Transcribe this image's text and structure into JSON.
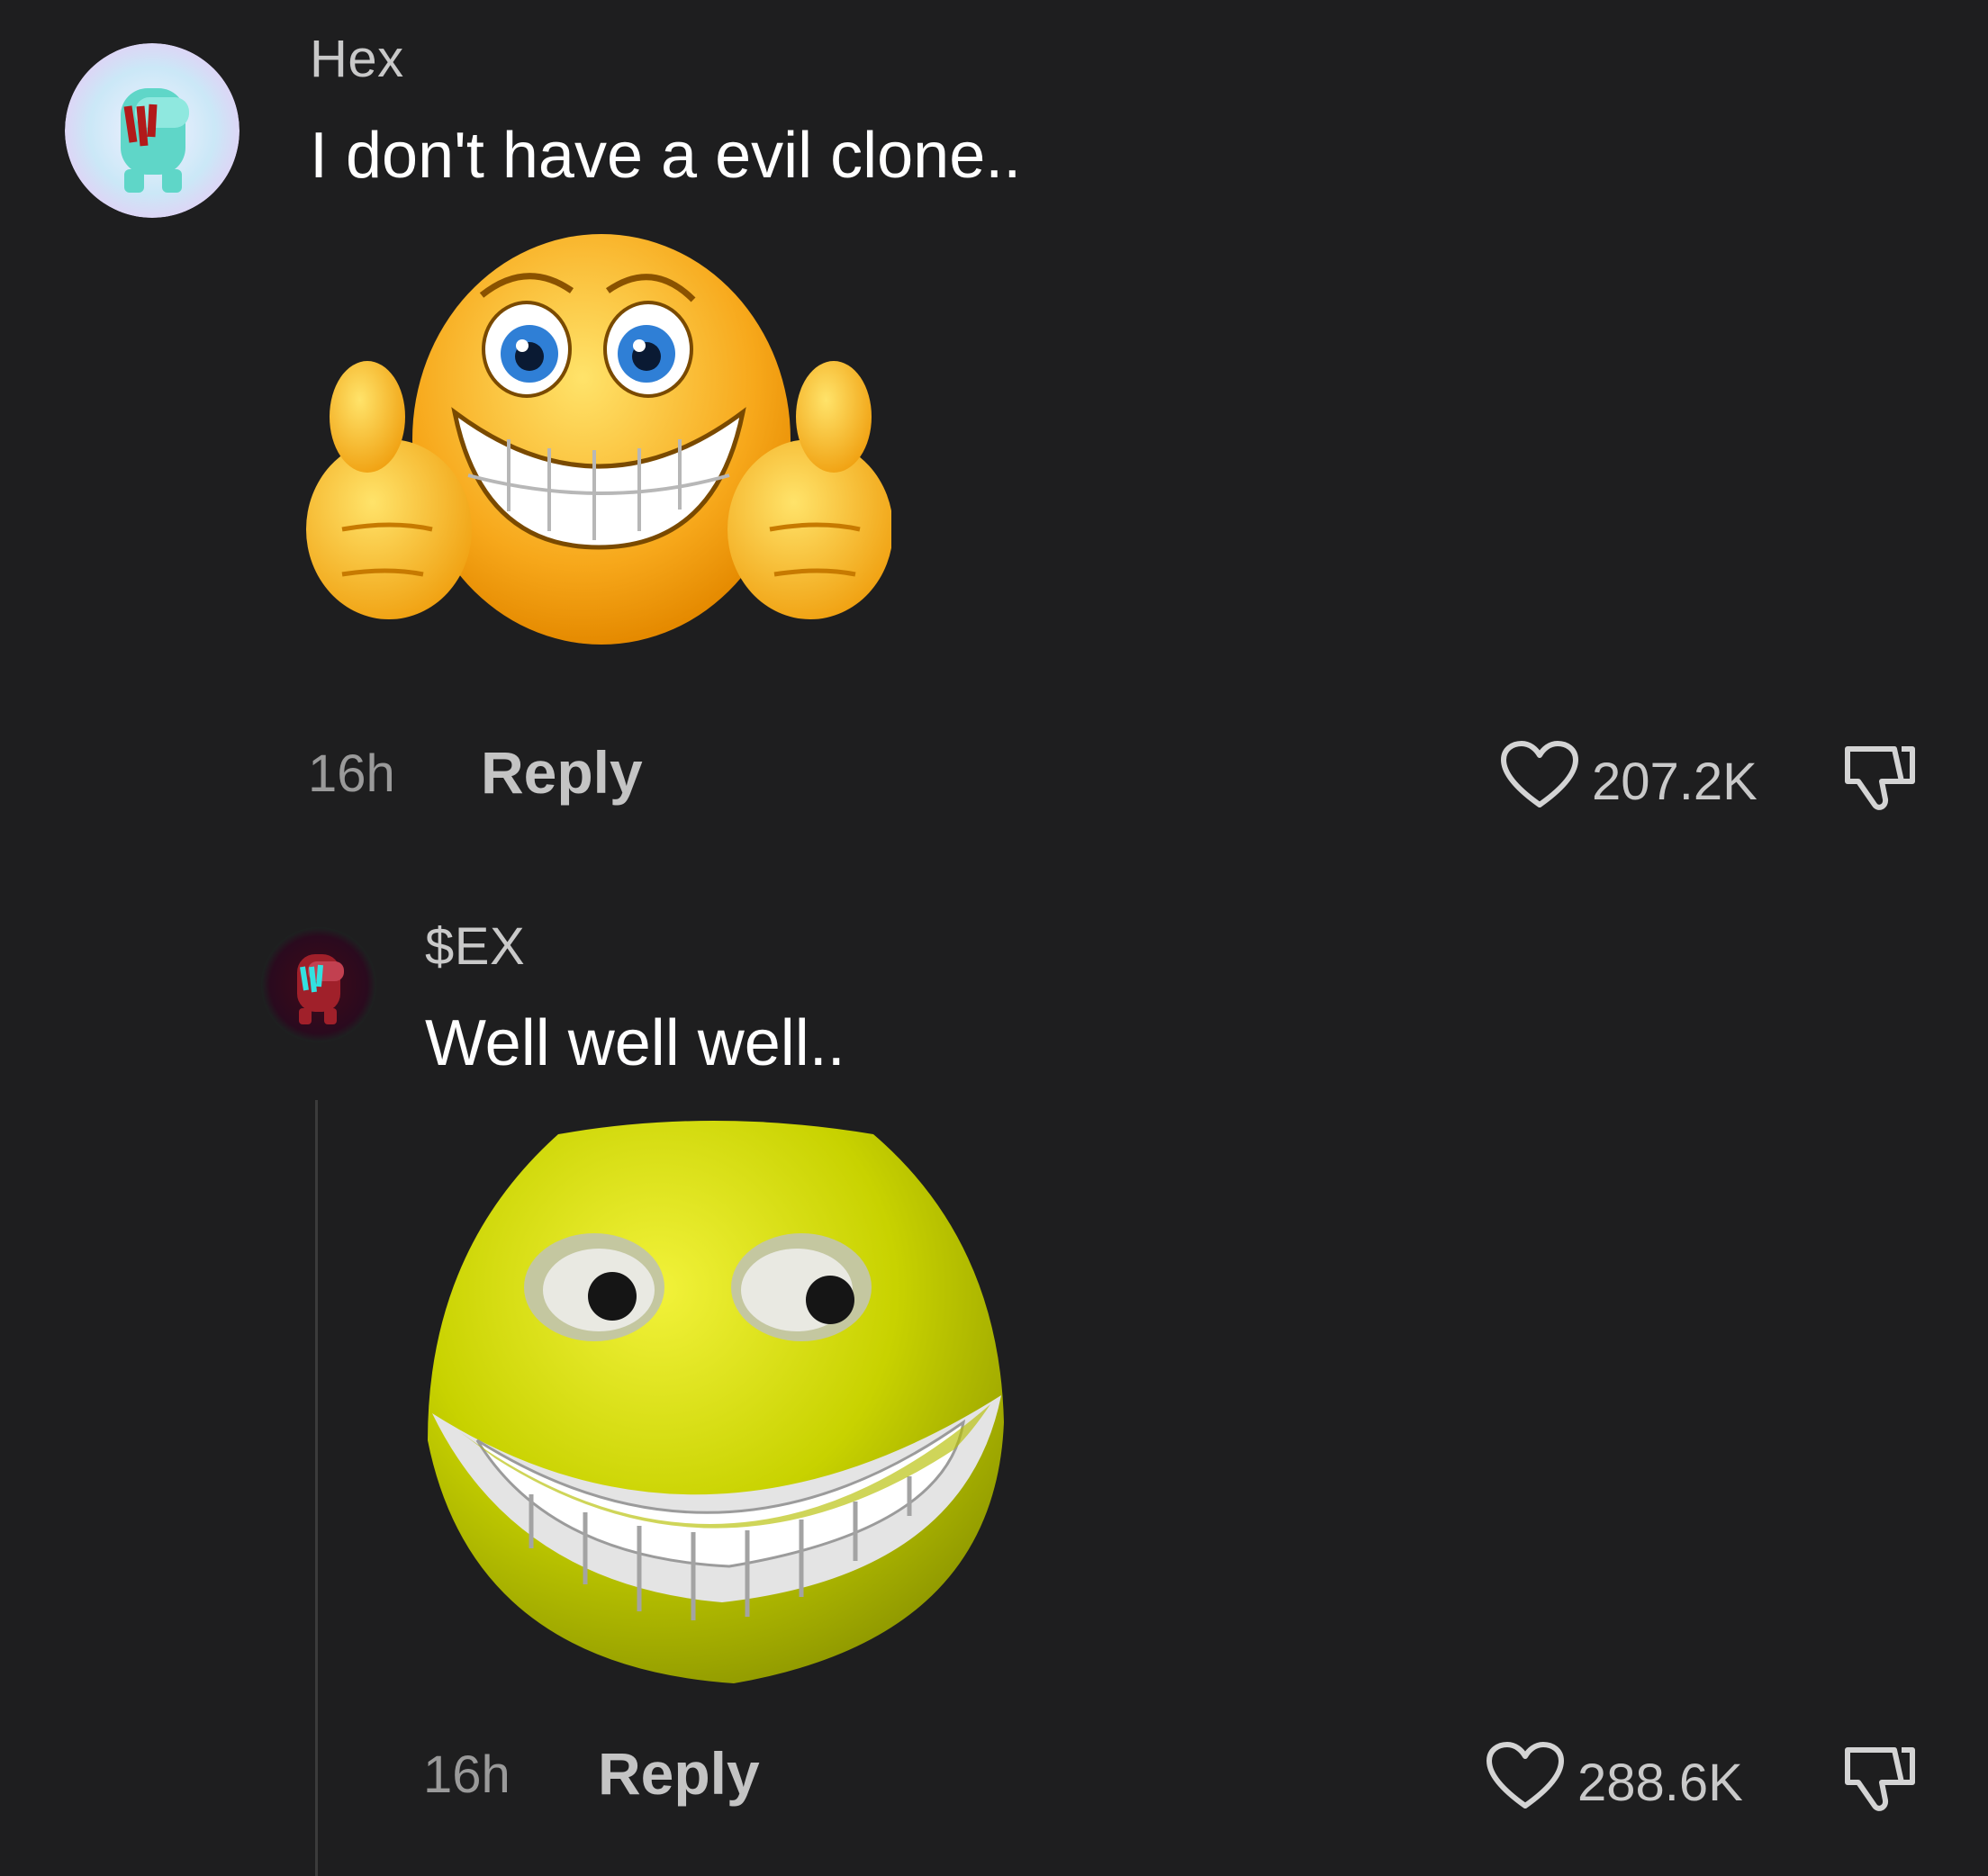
{
  "comments": [
    {
      "username": "Hex",
      "text": "I don't have a evil clone..",
      "time": "16h",
      "reply_label": "Reply",
      "likes": "207.2K",
      "media_icon": "thumbs-up-grin-emoji"
    },
    {
      "username": "$EX",
      "text": "Well well well..",
      "time": "16h",
      "reply_label": "Reply",
      "likes": "288.6K",
      "media_icon": "yellow-grin-meme-face"
    }
  ],
  "colors": {
    "background": "#1e1e1f",
    "text": "#ffffff",
    "muted": "#9a9a9a",
    "emoji_orange": "#f5a623",
    "meme_yellow": "#c9d400"
  }
}
